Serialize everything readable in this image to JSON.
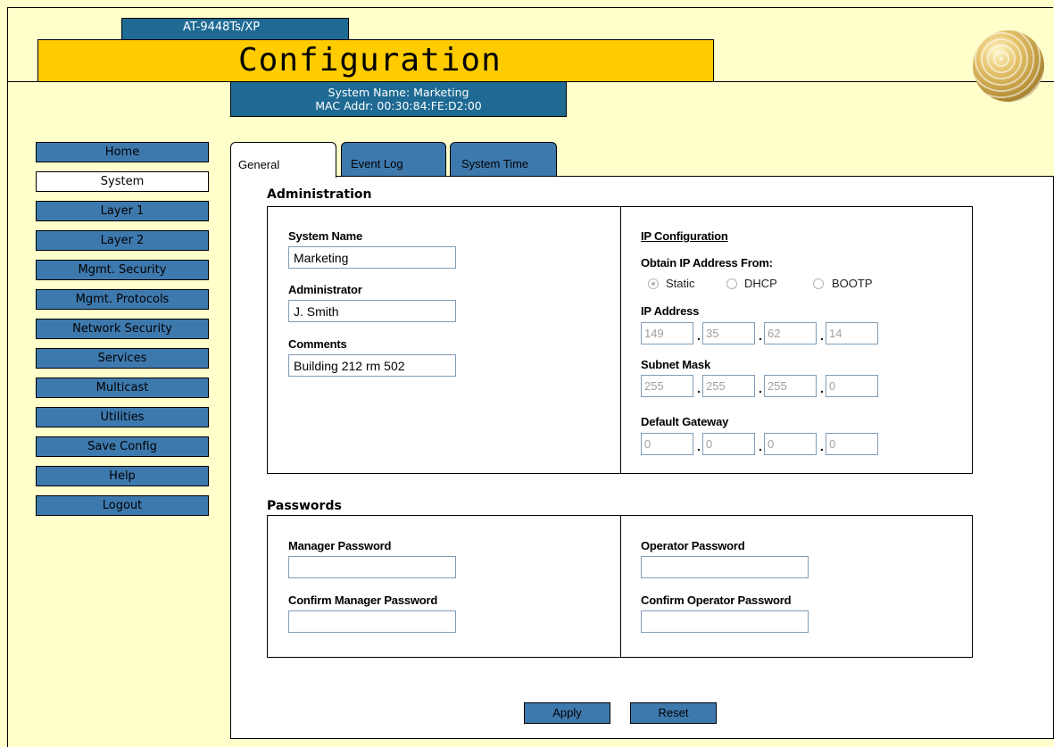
{
  "header": {
    "model": "AT-9448Ts/XP",
    "title": "Configuration",
    "system_name_line": "System Name: Marketing",
    "mac_line": "MAC Addr: 00:30:84:FE:D2:00"
  },
  "nav": {
    "items": [
      {
        "label": "Home"
      },
      {
        "label": "System",
        "active": true
      },
      {
        "label": "Layer 1"
      },
      {
        "label": "Layer 2"
      },
      {
        "label": "Mgmt. Security"
      },
      {
        "label": "Mgmt. Protocols"
      },
      {
        "label": "Network Security"
      },
      {
        "label": "Services"
      },
      {
        "label": "Multicast"
      },
      {
        "label": "Utilities"
      },
      {
        "label": "Save Config"
      },
      {
        "label": "Help"
      },
      {
        "label": "Logout"
      }
    ]
  },
  "tabs": {
    "general": "General",
    "event_log": "Event Log",
    "system_time": "System Time"
  },
  "administration": {
    "title": "Administration",
    "system_name_label": "System Name",
    "system_name_value": "Marketing",
    "administrator_label": "Administrator",
    "administrator_value": "J. Smith",
    "comments_label": "Comments",
    "comments_value": "Building 212 rm 502"
  },
  "ip_config": {
    "title": "IP Configuration",
    "obtain_label": "Obtain IP Address From:",
    "options": [
      "Static",
      "DHCP",
      "BOOTP"
    ],
    "selected": "Static",
    "ip_label": "IP Address",
    "ip": [
      "149",
      "35",
      "62",
      "14"
    ],
    "subnet_label": "Subnet Mask",
    "subnet": [
      "255",
      "255",
      "255",
      "0"
    ],
    "gateway_label": "Default Gateway",
    "gateway": [
      "0",
      "0",
      "0",
      "0"
    ]
  },
  "passwords": {
    "title": "Passwords",
    "manager_label": "Manager Password",
    "confirm_manager_label": "Confirm Manager Password",
    "operator_label": "Operator Password",
    "confirm_operator_label": "Confirm Operator Password"
  },
  "actions": {
    "apply": "Apply",
    "reset": "Reset"
  },
  "colors": {
    "background": "#FFFFCC",
    "title_bar": "#FFCC00",
    "header_blue": "#1E6A93",
    "button_blue": "#3E79AE"
  }
}
